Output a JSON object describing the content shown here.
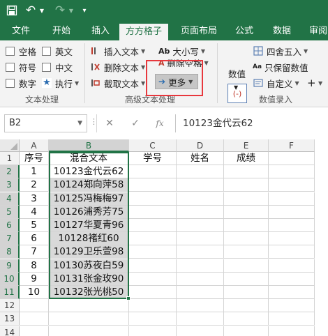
{
  "quick_access": {
    "save_icon": "save-icon",
    "undo_icon": "undo-icon",
    "redo_icon": "redo-icon",
    "customize_icon": "customize-qat-icon"
  },
  "tabs": [
    {
      "label": "文件"
    },
    {
      "label": "开始"
    },
    {
      "label": "插入"
    },
    {
      "label": "方方格子"
    },
    {
      "label": "页面布局"
    },
    {
      "label": "公式"
    },
    {
      "label": "数据"
    },
    {
      "label": "审阅"
    }
  ],
  "ribbon": {
    "text_processing": {
      "label": "文本处理",
      "checkboxes": [
        "空格",
        "英文",
        "符号",
        "中文",
        "数字"
      ],
      "execute_label": "执行"
    },
    "advanced_text": {
      "label": "高级文本处理",
      "insert_text": "插入文本",
      "delete_text": "删除文本",
      "extract_text": "截取文本",
      "case": "大小写",
      "delete_space": "删除空格",
      "more": "更多"
    },
    "numeric_input": {
      "label": "数值录入",
      "numeric": "数值",
      "round": "四舍五入",
      "keep_numbers": "只保留数值",
      "custom": "自定义"
    }
  },
  "formula_bar": {
    "name_box": "B2",
    "formula": "10123金代云62",
    "fx": "fx"
  },
  "sheet": {
    "columns": [
      "A",
      "B",
      "C",
      "D",
      "E",
      "F"
    ],
    "rows": [
      "1",
      "2",
      "3",
      "4",
      "5",
      "6",
      "7",
      "8",
      "9",
      "10",
      "11",
      "12",
      "13",
      "14"
    ],
    "header_row": [
      "序号",
      "混合文本",
      "学号",
      "姓名",
      "成绩"
    ],
    "data": [
      [
        "1",
        "10123金代云62"
      ],
      [
        "2",
        "10124郑向萍58"
      ],
      [
        "3",
        "10125冯梅梅97"
      ],
      [
        "4",
        "10126浦秀芳75"
      ],
      [
        "5",
        "10127华夏青96"
      ],
      [
        "6",
        "10128褚红60"
      ],
      [
        "7",
        "10129卫乐萱98"
      ],
      [
        "8",
        "10130苏夜白59"
      ],
      [
        "9",
        "10131张金玫90"
      ],
      [
        "10",
        "10132张光桃50"
      ]
    ]
  }
}
